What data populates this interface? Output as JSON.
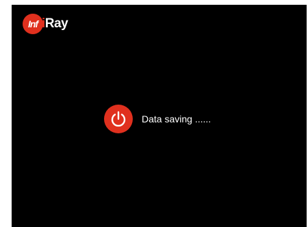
{
  "brand": {
    "badge_text": "Inf",
    "word_red": "i",
    "word_white": "Ray",
    "color": "#e0301e"
  },
  "status": {
    "icon": "power-icon",
    "text": "Data saving ......"
  },
  "colors": {
    "screen_background": "#000000",
    "accent": "#e0301e",
    "text": "#ffffff"
  }
}
